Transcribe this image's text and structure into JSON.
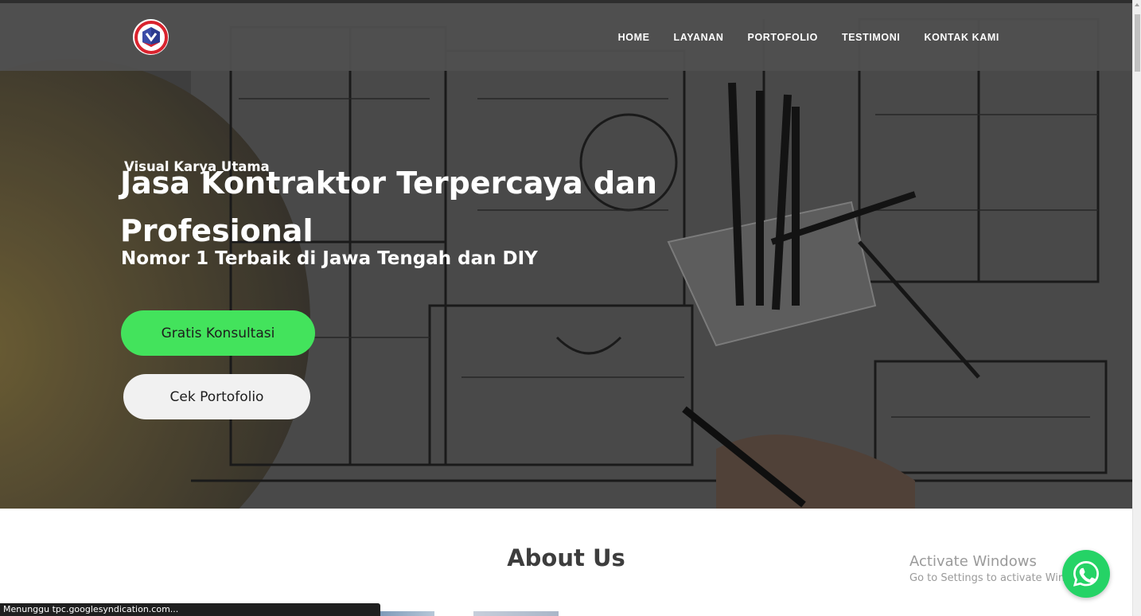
{
  "nav": {
    "items": [
      "HOME",
      "LAYANAN",
      "PORTOFOLIO",
      "TESTIMONI",
      "KONTAK KAMI"
    ],
    "logo_icon": "company-logo-icon"
  },
  "hero": {
    "brand": "Visual Karya Utama",
    "title": "Jasa Kontraktor Terpercaya dan Profesional",
    "subtitle": "Nomor 1 Terbaik di Jawa Tengah dan DIY",
    "primary_button": "Gratis Konsultasi",
    "secondary_button": "Cek Portofolio"
  },
  "about": {
    "title": "About Us"
  },
  "watermark": {
    "title": "Activate Windows",
    "subtitle": "Go to Settings to activate Windows."
  },
  "status_bar": {
    "text": "Menunggu tpc.googlesyndication.com..."
  },
  "colors": {
    "nav_bg": "#505050",
    "primary_button": "#43e35c",
    "secondary_button": "#f1f1f1",
    "whatsapp": "#25d366",
    "logo_red": "#d9232e",
    "logo_blue": "#2b3a8f"
  }
}
